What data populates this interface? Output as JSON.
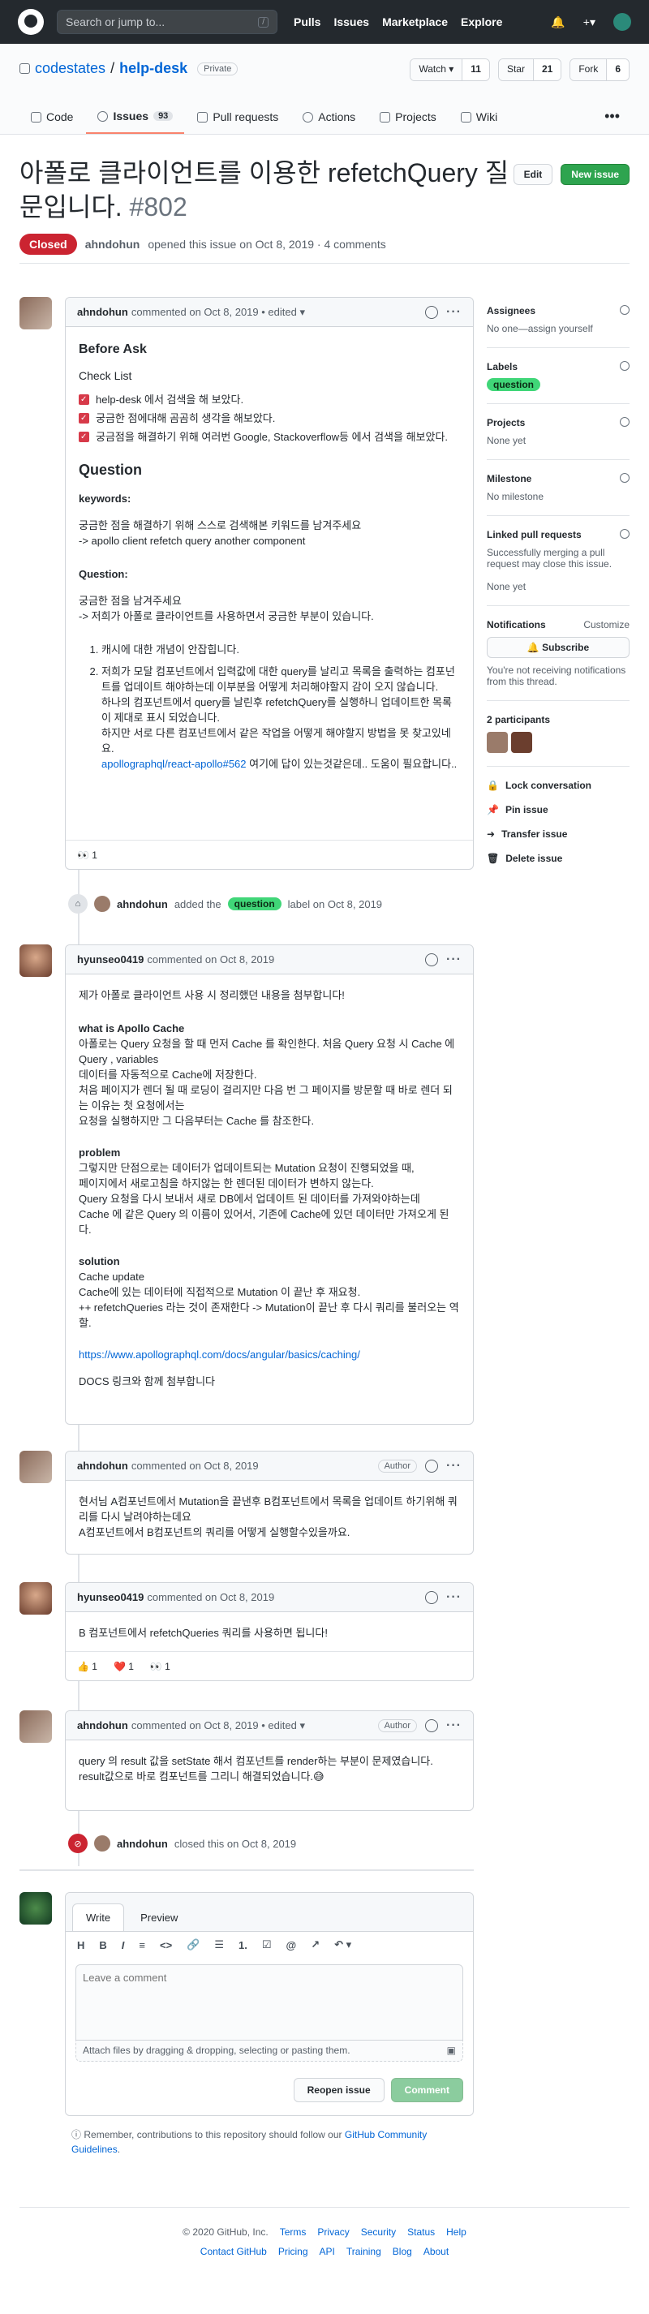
{
  "header": {
    "search_placeholder": "Search or jump to...",
    "search_key": "/",
    "nav": [
      "Pulls",
      "Issues",
      "Marketplace",
      "Explore"
    ],
    "plus": "+▾",
    "bell": "🔔"
  },
  "repo": {
    "owner": "codestates",
    "name": "help-desk",
    "visibility": "Private",
    "watch_label": "Watch ▾",
    "watch_count": "11",
    "star_label": "Star",
    "star_count": "21",
    "fork_label": "Fork",
    "fork_count": "6",
    "tabs": [
      {
        "label": "Code"
      },
      {
        "label": "Issues",
        "count": "93"
      },
      {
        "label": "Pull requests"
      },
      {
        "label": "Actions"
      },
      {
        "label": "Projects"
      },
      {
        "label": "Wiki"
      }
    ],
    "more": "•••"
  },
  "issue": {
    "title": "아폴로 클라이언트를 이용한 refetchQuery 질문입니다.",
    "number": "#802",
    "edit": "Edit",
    "new_issue": "New issue",
    "state": "Closed",
    "author": "ahndohun",
    "meta": "opened this issue on Oct 8, 2019 · 4 comments"
  },
  "c1": {
    "user": "ahndohun",
    "meta": "commented on Oct 8, 2019 • edited ▾",
    "h_before": "Before Ask",
    "h_check": "Check List",
    "checks": [
      "help-desk 에서 검색을 해 보았다.",
      "궁금한 점에대해 곰곰히 생각을 해보았다.",
      "궁금점을 해결하기 위해 여러번 Google, Stackoverflow등 에서 검색을 해보았다."
    ],
    "h_question": "Question",
    "kw_label": "keywords:",
    "kw1": "궁금한 점을 해결하기 위해 스스로 검색해본 키워드를 남겨주세요",
    "kw2": "-> apollo client refetch query another component",
    "q_label": "Question:",
    "q1": "궁금한 점을 남겨주세요",
    "q2": "-> 저희가 아폴로 클라이언트를 사용하면서 궁금한 부분이 있습니다.",
    "li1": "캐시에 대한 개념이 안잡힙니다.",
    "li2a": "저희가 모달 컴포넌트에서 입력값에 대한 query를 날리고 목록을 출력하는 컴포넌트를 업데이트 해야하는데 이부분을 어떻게 처리해야할지 감이 오지 않습니다.",
    "li2b": "하나의 컴포넌트에서 query를 날린후 refetchQuery를 실행하니 업데이트한 목록이 제대로 표시 되었습니다.",
    "li2c": "하지만 서로 다른 컴포넌트에서 같은 작업을 어떻게 해야할지 방법을 못 찾고있네요.",
    "li2_link": "apollographql/react-apollo#562",
    "li2_rest": "여기에 답이 있는것같은데.. 도움이 필요합니다..",
    "reaction": "👀 1"
  },
  "ev_label": {
    "user": "ahndohun",
    "text1": "added the",
    "label": "question",
    "text2": "label on Oct 8, 2019"
  },
  "c2": {
    "user": "hyunseo0419",
    "meta": "commented on Oct 8, 2019",
    "p1": "제가 아폴로 클라이언트 사용 시 정리했던 내용을 첨부합니다!",
    "h1": "what is Apollo Cache",
    "a1": "아폴로는 Query 요청을 할 때 먼저 Cache 를 확인한다. 처음 Query 요청 시 Cache 에 Query , variables",
    "a2": "데이터를 자동적으로 Cache에 저장한다.",
    "a3": "처음 페이지가 렌더 될 때 로딩이 걸리지만 다음 번 그 페이지를 방문할 때 바로 렌더 되는 이유는 첫 요청에서는",
    "a4": "요청을 실행하지만 그 다음부터는 Cache 를 참조한다.",
    "h2": "problem",
    "b1": "그렇지만 단점으로는 데이터가 업데이트되는 Mutation 요청이 진행되었을 때,",
    "b2": "페이지에서 새로고침을 하지않는 한 렌더된 데이터가 변하지 않는다.",
    "b3": "Query 요청을 다시 보내서 새로 DB에서 업데이트 된 데이터를 가져와야하는데",
    "b4": "Cache 에 같은 Query 의 이름이 있어서, 기존에 Cache에 있던 데이터만 가져오게 된다.",
    "h3": "solution",
    "s1": "Cache update",
    "s2": "Cache에 있는 데이터에 직접적으로 Mutation 이 끝난 후 재요청.",
    "s3": "++ refetchQueries 라는 것이 존재한다 -> Mutation이 끝난 후 다시 쿼리를 불러오는 역할.",
    "link": "https://www.apollographql.com/docs/angular/basics/caching/",
    "p_last": "DOCS 링크와 함께 첨부합니다"
  },
  "c3": {
    "user": "ahndohun",
    "meta": "commented on Oct 8, 2019",
    "badge": "Author",
    "t1": "현서님 A컴포넌트에서 Mutation을 끝낸후 B컴포넌트에서 목록을 업데이트 하기위해 쿼리를 다시 날려야하는데요",
    "t2": "A컴포넌트에서 B컴포넌트의 쿼리를 어떻게 실행할수있을까요."
  },
  "c4": {
    "user": "hyunseo0419",
    "meta": "commented on Oct 8, 2019",
    "t1": "B 컴포넌트에서 refetchQueries 쿼리를 사용하면 됩니다!",
    "r1": "👍 1",
    "r2": "❤️ 1",
    "r3": "👀 1"
  },
  "c5": {
    "user": "ahndohun",
    "meta": "commented on Oct 8, 2019 • edited ▾",
    "badge": "Author",
    "t1": "query 의 result 값을 setState 해서 컴포넌트를 render하는 부분이 문제였습니다.",
    "t2": "result값으로 바로 컴포넌트를 그리니 해결되었습니다.😅"
  },
  "ev_closed": {
    "user": "ahndohun",
    "text": "closed this on Oct 8, 2019"
  },
  "composer": {
    "tab_write": "Write",
    "tab_preview": "Preview",
    "placeholder": "Leave a comment",
    "attach": "Attach files by dragging & dropping, selecting or pasting them.",
    "reopen": "Reopen issue",
    "comment": "Comment",
    "toolbar": [
      "H",
      "B",
      "I",
      "≡",
      "<>",
      "🔗",
      "☰",
      "1.",
      "☑",
      "@",
      "↗",
      "↶ ▾"
    ],
    "note_pre": "Remember, contributions to this repository should follow our",
    "note_link": "GitHub Community Guidelines",
    "note_post": "."
  },
  "sidebar": {
    "assignees_title": "Assignees",
    "assignees_value": "No one—assign yourself",
    "labels_title": "Labels",
    "label_value": "question",
    "projects_title": "Projects",
    "projects_value": "None yet",
    "milestone_title": "Milestone",
    "milestone_value": "No milestone",
    "linked_title": "Linked pull requests",
    "linked_desc": "Successfully merging a pull request may close this issue.",
    "linked_value": "None yet",
    "notif_title": "Notifications",
    "notif_customize": "Customize",
    "subscribe": "🔔 Subscribe",
    "notif_desc": "You're not receiving notifications from this thread.",
    "participants": "2 participants",
    "lock": "Lock conversation",
    "pin": "Pin issue",
    "transfer": "Transfer issue",
    "delete": "Delete issue"
  },
  "footer": {
    "copyright": "© 2020 GitHub, Inc.",
    "row1": [
      "Terms",
      "Privacy",
      "Security",
      "Status",
      "Help"
    ],
    "row2": [
      "Contact GitHub",
      "Pricing",
      "API",
      "Training",
      "Blog",
      "About"
    ]
  }
}
